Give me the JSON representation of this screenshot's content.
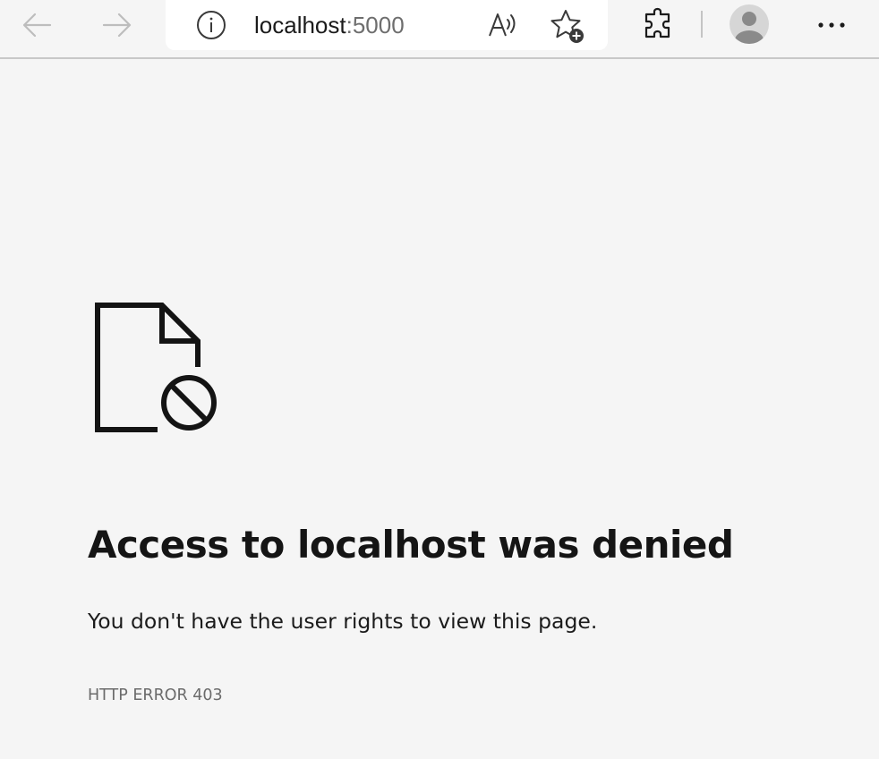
{
  "browser": {
    "address": {
      "host": "localhost",
      "port": ":5000"
    },
    "icons": {
      "back": "arrow-left-icon",
      "forward": "arrow-right-icon",
      "site_info": "info-icon",
      "read_aloud": "read-aloud-icon",
      "favorite": "star-add-icon",
      "extensions": "puzzle-icon",
      "profile": "avatar",
      "more": "ellipsis-icon"
    }
  },
  "page": {
    "icon": "document-blocked-icon",
    "title": "Access to localhost was denied",
    "description": "You don't have the user rights to view this page.",
    "error_code": "HTTP ERROR 403"
  },
  "colors": {
    "background": "#f5f5f5",
    "address_bar": "#ffffff",
    "text": "#1b1b1b",
    "muted": "#6b6b6b",
    "disabled_nav": "#bdbdbd"
  }
}
